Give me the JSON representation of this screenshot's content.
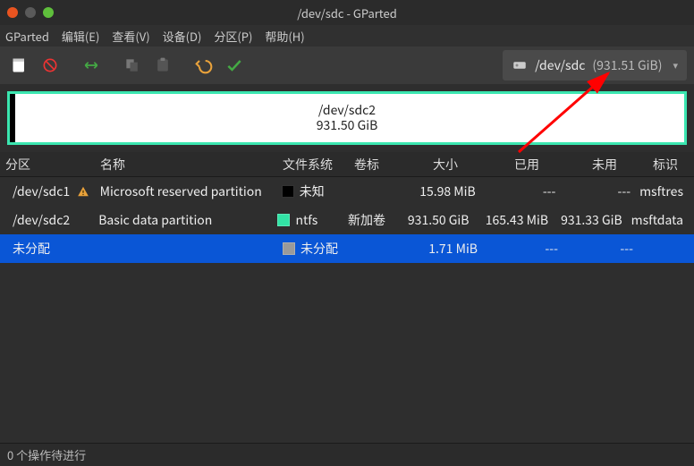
{
  "window": {
    "title": "/dev/sdc - GParted"
  },
  "menubar": {
    "items": [
      "GParted",
      "编辑(E)",
      "查看(V)",
      "设备(D)",
      "分区(P)",
      "帮助(H)"
    ]
  },
  "toolbar": {
    "icons": [
      "new",
      "delete",
      "resize",
      "copy",
      "paste",
      "undo",
      "apply"
    ]
  },
  "device_selector": {
    "device": "/dev/sdc",
    "size": "(931.51 GiB)"
  },
  "visualizer": {
    "selected_partition": "/dev/sdc2",
    "selected_size": "931.50 GiB"
  },
  "columns": {
    "partition": "分区",
    "name": "名称",
    "filesystem": "文件系统",
    "label": "卷标",
    "size": "大小",
    "used": "已用",
    "unused": "未用",
    "flags": "标识"
  },
  "rows": [
    {
      "partition": "/dev/sdc1",
      "warn": true,
      "name": "Microsoft reserved partition",
      "fs_class": "fs-unknown",
      "filesystem": "未知",
      "label": "",
      "size": "15.98 MiB",
      "used": "---",
      "unused": "---",
      "flags": "msftres",
      "selected": false
    },
    {
      "partition": "/dev/sdc2",
      "warn": false,
      "name": "Basic data partition",
      "fs_class": "fs-ntfs",
      "filesystem": "ntfs",
      "label": "新加卷",
      "size": "931.50 GiB",
      "used": "165.43 MiB",
      "unused": "931.33 GiB",
      "flags": "msftdata",
      "selected": false
    },
    {
      "partition": "未分配",
      "warn": false,
      "name": "",
      "fs_class": "fs-unalloc",
      "filesystem": "未分配",
      "label": "",
      "size": "1.71 MiB",
      "used": "---",
      "unused": "---",
      "flags": "",
      "selected": true
    }
  ],
  "statusbar": {
    "text": "0 个操作待进行"
  }
}
